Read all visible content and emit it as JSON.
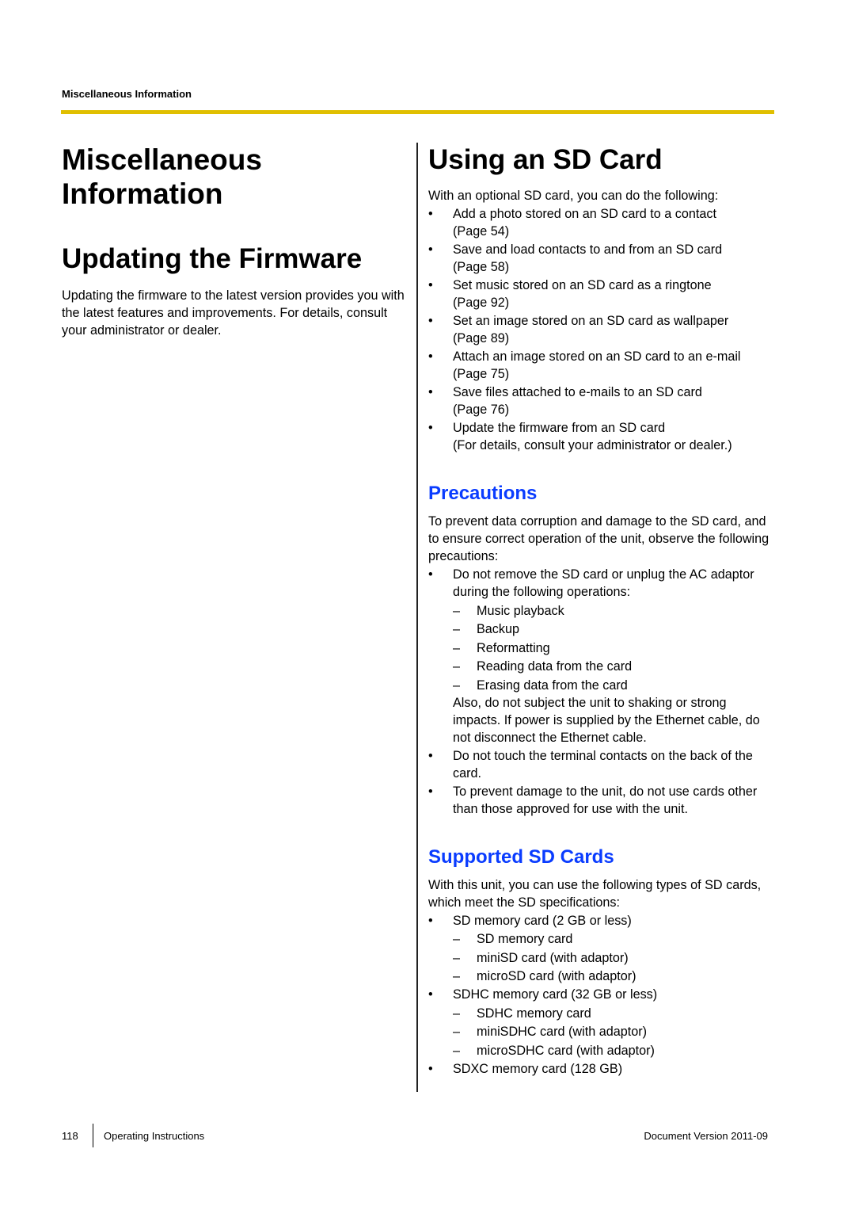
{
  "header": {
    "running_title": "Miscellaneous Information",
    "rule_color": "#e0bf00"
  },
  "left": {
    "chapter_title_line1": "Miscellaneous",
    "chapter_title_line2": "Information",
    "firmware": {
      "title": "Updating the Firmware",
      "body": "Updating the firmware to the latest version provides you with the latest features and improvements. For details, consult your administrator or dealer."
    }
  },
  "right": {
    "title": "Using an SD Card",
    "intro": "With an optional SD card, you can do the following:",
    "bullet_glyph": "•",
    "dash_glyph": "–",
    "items": [
      {
        "text": "Add a photo stored on an SD card to a contact",
        "ref": "(Page 54)"
      },
      {
        "text": "Save and load contacts to and from an SD card",
        "ref": "(Page 58)"
      },
      {
        "text": "Set music stored on an SD card as a ringtone",
        "ref": "(Page 92)"
      },
      {
        "text": "Set an image stored on an SD card as wallpaper",
        "ref": "(Page 89)"
      },
      {
        "text": "Attach an image stored on an SD card to an e-mail",
        "ref": "(Page 75)"
      },
      {
        "text": "Save files attached to e-mails to an SD card",
        "ref": "(Page 76)"
      },
      {
        "text": "Update the firmware from an SD card",
        "ref": "(For details, consult your administrator or dealer.)"
      }
    ],
    "precautions": {
      "title": "Precautions",
      "heading_color": "#0a3cff",
      "intro": "To prevent data corruption and damage to the SD card, and to ensure correct operation of the unit, observe the following precautions:",
      "item1": "Do not remove the SD card or unplug the AC adaptor during the following operations:",
      "operations": [
        "Music playback",
        "Backup",
        "Reformatting",
        "Reading data from the card",
        "Erasing data from the card"
      ],
      "item1_note": "Also, do not subject the unit to shaking or strong impacts. If power is supplied by the Ethernet cable, do not disconnect the Ethernet cable.",
      "item2": "Do not touch the terminal contacts on the back of the card.",
      "item3": "To prevent damage to the unit, do not use cards other than those approved for use with the unit."
    },
    "supported": {
      "title": "Supported SD Cards",
      "intro": "With this unit, you can use the following types of SD cards, which meet the SD specifications:",
      "groups": [
        {
          "label": "SD memory card (2 GB or less)",
          "subs": [
            "SD memory card",
            "miniSD card (with adaptor)",
            "microSD card (with adaptor)"
          ]
        },
        {
          "label": "SDHC memory card (32 GB or less)",
          "subs": [
            "SDHC memory card",
            "miniSDHC card (with adaptor)",
            "microSDHC card (with adaptor)"
          ]
        },
        {
          "label": "SDXC memory card (128 GB)",
          "subs": []
        }
      ]
    }
  },
  "footer": {
    "page_number": "118",
    "doc_title": "Operating Instructions",
    "version_label": "Document Version  2011-09"
  }
}
